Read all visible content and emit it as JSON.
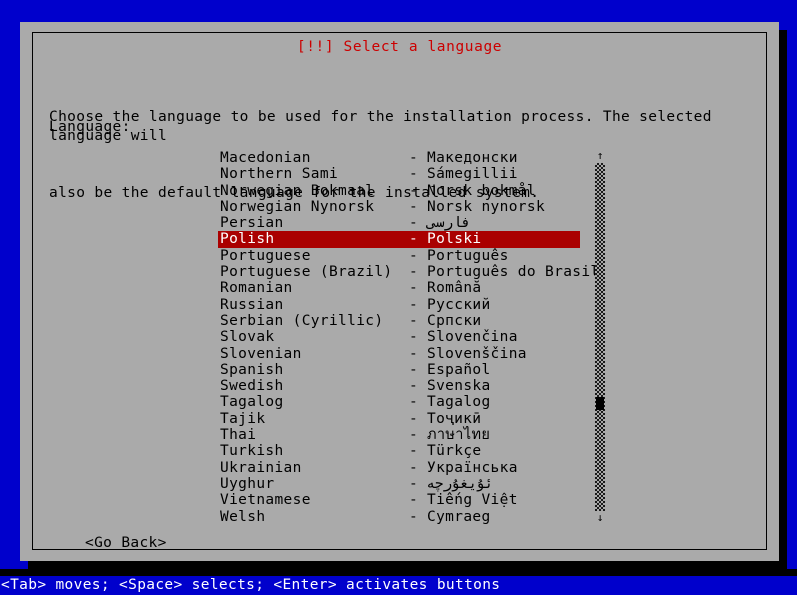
{
  "screen": {
    "background_color": "#0000cc",
    "dialog_background_color": "#aaaaaa",
    "title_color": "#cc0000",
    "highlight_color": "#aa0000",
    "highlight_text_color": "#ffffff"
  },
  "dialog": {
    "title": "[!!] Select a language",
    "body_line_1": "Choose the language to be used for the installation process. The selected language will",
    "body_line_2": "also be the default language for the installed system.",
    "field_label": "Language:",
    "go_back_label": "<Go Back>"
  },
  "language_list": {
    "separator": "-",
    "selected_index": 5,
    "items": [
      {
        "name": "Macedonian",
        "native": "Македонски"
      },
      {
        "name": "Northern Sami",
        "native": "Sámegillii"
      },
      {
        "name": "Norwegian Bokmaal",
        "native": "Norsk bokmål"
      },
      {
        "name": "Norwegian Nynorsk",
        "native": "Norsk nynorsk"
      },
      {
        "name": "Persian",
        "native": "فارسی"
      },
      {
        "name": "Polish",
        "native": "Polski"
      },
      {
        "name": "Portuguese",
        "native": "Português"
      },
      {
        "name": "Portuguese (Brazil)",
        "native": "Português do Brasil"
      },
      {
        "name": "Romanian",
        "native": "Română"
      },
      {
        "name": "Russian",
        "native": "Русский"
      },
      {
        "name": "Serbian (Cyrillic)",
        "native": "Српски"
      },
      {
        "name": "Slovak",
        "native": "Slovenčina"
      },
      {
        "name": "Slovenian",
        "native": "Slovenščina"
      },
      {
        "name": "Spanish",
        "native": "Español"
      },
      {
        "name": "Swedish",
        "native": "Svenska"
      },
      {
        "name": "Tagalog",
        "native": "Tagalog"
      },
      {
        "name": "Tajik",
        "native": "Тоҷикӣ"
      },
      {
        "name": "Thai",
        "native": "ภาษาไทย"
      },
      {
        "name": "Turkish",
        "native": "Türkçe"
      },
      {
        "name": "Ukrainian",
        "native": "Українська"
      },
      {
        "name": "Uyghur",
        "native": "ئۇيغۇرچە"
      },
      {
        "name": "Vietnamese",
        "native": "Tiếng Việt"
      },
      {
        "name": "Welsh",
        "native": "Cymraeg"
      }
    ]
  },
  "scrollbar": {
    "up_arrow": "↑",
    "down_arrow": "↓",
    "thumb_position_percent": 70
  },
  "status_bar": {
    "text": "<Tab> moves; <Space> selects; <Enter> activates buttons"
  }
}
